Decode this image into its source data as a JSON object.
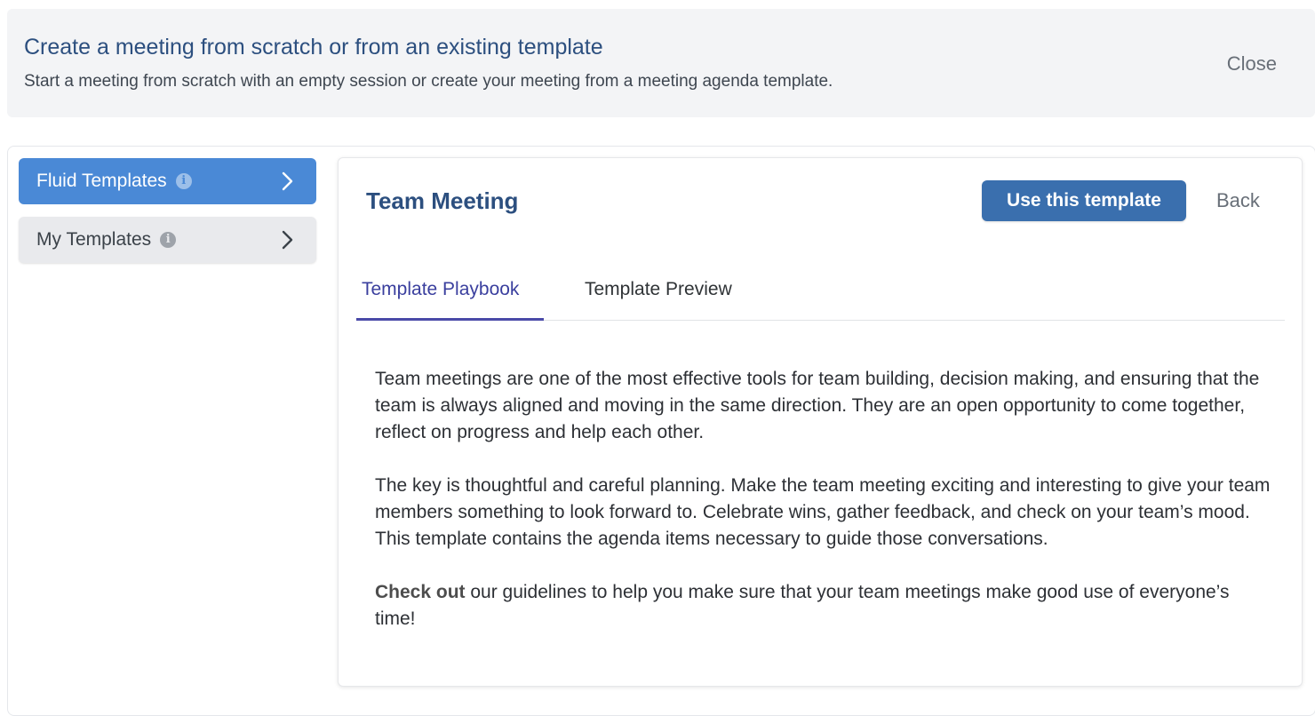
{
  "header": {
    "title": "Create a meeting from scratch or from an existing template",
    "subtitle": "Start a meeting from scratch with an empty session or create your meeting from a meeting agenda template.",
    "close_label": "Close"
  },
  "sidebar": {
    "items": [
      {
        "label": "Fluid Templates",
        "icon": "info-icon",
        "active": true
      },
      {
        "label": "My Templates",
        "icon": "info-icon",
        "active": false
      }
    ]
  },
  "panel": {
    "title": "Team Meeting",
    "use_button_label": "Use this template",
    "back_label": "Back",
    "tabs": [
      {
        "label": "Template Playbook",
        "active": true
      },
      {
        "label": "Template Preview",
        "active": false
      }
    ],
    "paragraphs": [
      "Team meetings are one of the most effective tools for team building, decision making, and ensuring that the team is always aligned and moving in the same direction. They are an open opportunity to come together, reflect on progress and help each other.",
      "The key is thoughtful and careful planning. Make the team meeting exciting and interesting to give your team members something to look forward to. Celebrate wins, gather feedback, and check on your team’s mood. This template contains the agenda items necessary to guide those conversations."
    ],
    "check_out_bold": "Check out",
    "check_out_rest": " our guidelines to help you make sure that your team meetings make good use of everyone’s time!"
  },
  "colors": {
    "accent_blue": "#4a89d6",
    "button_blue": "#3a6fae",
    "title_blue": "#2c4f7f",
    "tab_active": "#3a3f9e"
  }
}
